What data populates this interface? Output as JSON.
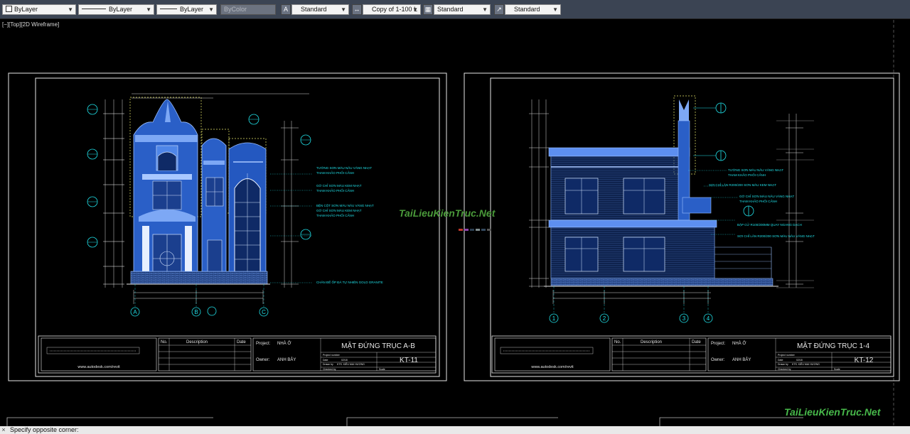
{
  "toolbar": {
    "color": "ByLayer",
    "linetype": "ByLayer",
    "lineweight": "ByLayer",
    "plotstyle": "ByColor",
    "text_style": "Standard",
    "dim_style": "Copy of 1-100 L",
    "table_style": "Standard",
    "multileader_style": "Standard"
  },
  "viewport": {
    "label": "[−][Top][2D Wireframe]"
  },
  "sheets": [
    {
      "title": "MẶT ĐỨNG TRỤC A-B",
      "sheet_number": "KT-11",
      "grid_labels": [
        "A",
        "B",
        "C"
      ],
      "annotations": [
        "TƯỜNG SƠN MÀU NÂU VÀNG NHẠT",
        "THAM KHẢO PHỐI CẢNH",
        "GỜ CHỈ SƠN MÀU KEM NHẠT",
        "THAM KHẢO PHỐI CẢNH",
        "BỆN CỘT SƠN MÀU NÂU VÀNG NHẠT",
        "GỜ CHỈ SƠN MÀU KEM NHẠT",
        "THAM KHẢO PHỐI CẢNH",
        "CHÂN ĐẾ ỐP ĐÁ TỰ NHIÊN GOLD GRANITE"
      ]
    },
    {
      "title": "MẶT ĐỨNG TRỤC 1-4",
      "sheet_number": "KT-12",
      "grid_labels": [
        "1",
        "2",
        "3",
        "4"
      ],
      "annotations": [
        "TƯỜNG SƠN MÀU NÂU VÀNG NHẠT",
        "THAM KHẢO PHỐI CẢNH",
        "SƠI CHỈ LĂN R200/200 SƠN MÀU KEM NHẠT",
        "GỜ CHỈ SƠN MÀU NÂU VÀNG NHẠT",
        "THAM KHẢO PHỐI CẢNH",
        "BẬP CỬ R100/200MM QUAY NGANG DẠCH",
        "SƠI CHỈ LĂN R200/200 SƠN MÀU NÂU VÀNG NHẠT"
      ]
    }
  ],
  "title_block": {
    "no_label": "No.",
    "description_label": "Description",
    "date_label": "Date",
    "project_label": "Project:",
    "project_value": "NHÀ Ở",
    "owner_label": "Owner:",
    "owner_value": "ANH BẢY",
    "project_number_label": "Project number",
    "date_field_label": "Date",
    "date_value": "02/18",
    "drawn_by_label": "Drawn by",
    "drawn_by_value": "KTS. KIỀU MAI HƯƠNG",
    "checked_by_label": "Checked by",
    "scale_label": "Scale",
    "website": "www.autodesk.com/revit"
  },
  "watermark": "TaiLieuKienTruc.Net",
  "command_line": {
    "prompt": "Specify opposite corner:"
  },
  "colors": {
    "drawing_lines": "#e6e6e6",
    "building": "#7da8f5",
    "annotation": "#20e0e8",
    "dim_lines": "#d8d8d8",
    "hatch_yellow": "#e8e86a",
    "watermark": "#47b84a"
  }
}
